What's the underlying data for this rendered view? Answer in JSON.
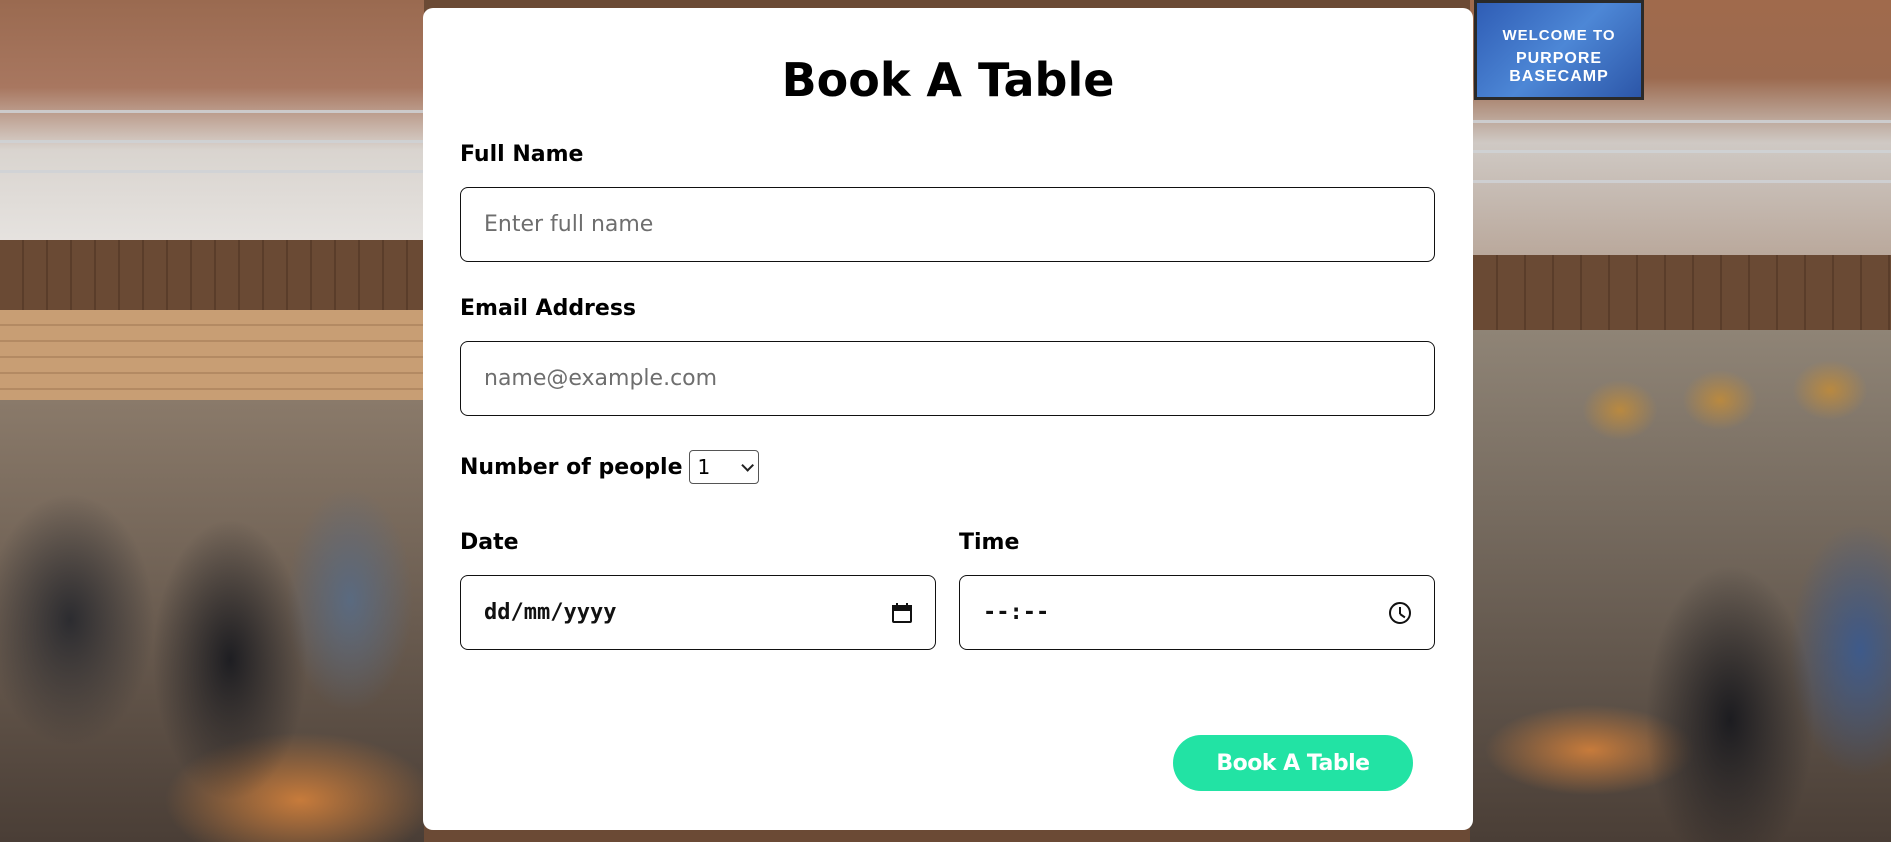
{
  "background": {
    "sign_line1": "WELCOME TO",
    "sign_line2": "PURPORE BASECAMP"
  },
  "form": {
    "title": "Book A Table",
    "full_name": {
      "label": "Full Name",
      "placeholder": "Enter full name",
      "value": ""
    },
    "email": {
      "label": "Email Address",
      "placeholder": "name@example.com",
      "value": ""
    },
    "people": {
      "label": "Number of people",
      "selected": "1"
    },
    "date": {
      "label": "Date",
      "placeholder": "dd/mm/yyyy"
    },
    "time": {
      "label": "Time",
      "placeholder": "--:--"
    },
    "submit_label": "Book A Table"
  },
  "colors": {
    "button": "#22e3a4",
    "card": "#ffffff"
  },
  "icons": [
    "calendar-icon",
    "clock-icon",
    "chevron-down-icon"
  ]
}
